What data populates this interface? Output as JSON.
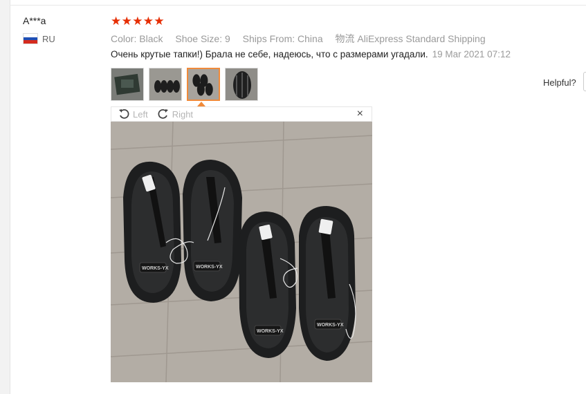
{
  "buyer": {
    "name": "A***a",
    "country": "RU"
  },
  "review": {
    "rating": 5,
    "stars": [
      "★",
      "★",
      "★",
      "★",
      "★"
    ],
    "attributes": [
      {
        "key": "Color:",
        "value": "Black"
      },
      {
        "key": "Shoe Size:",
        "value": "9"
      },
      {
        "key": "Ships From:",
        "value": "China"
      },
      {
        "key": "物流",
        "value": "AliExpress Standard Shipping"
      }
    ],
    "text": "Очень крутые тапки!) Брала не себе, надеюсь, что с размерами угадали.",
    "date": "19 Mar 2021 07:12"
  },
  "thumbnails": {
    "count": 4,
    "selected_index": 2
  },
  "viewer": {
    "rotate_left_label": "Left",
    "rotate_right_label": "Right",
    "close_label": "×"
  },
  "photo": {
    "brand_label": "WORKS-YX"
  },
  "helpful": {
    "label": "Helpful?"
  },
  "colors": {
    "star": "#e62e04",
    "active_thumb_border": "#f08a3a",
    "muted_text": "#999999",
    "flag_white": "#ffffff",
    "flag_blue": "#1f4fb5",
    "flag_red": "#d52b1e"
  }
}
